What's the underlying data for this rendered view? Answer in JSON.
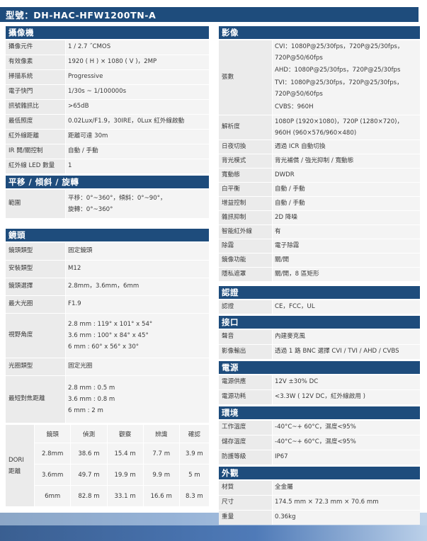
{
  "model": "型號：DH-HAC-HFW1200TN-A",
  "left": {
    "camera": {
      "title": "攝像機",
      "rows": [
        {
          "k": "攝像元件",
          "v": [
            "1 / 2.7 ˝CMOS"
          ]
        },
        {
          "k": "有效像素",
          "v": [
            "1920 ( H ) × 1080 ( V )，2MP"
          ]
        },
        {
          "k": "掃描系統",
          "v": [
            "Progressive"
          ]
        },
        {
          "k": "電子快門",
          "v": [
            "1/30s ~ 1/100000s"
          ]
        },
        {
          "k": "訊號雜訊比",
          "v": [
            ">65dB"
          ]
        },
        {
          "k": "最低照度",
          "v": [
            "0.02Lux/F1.9，30IRE，0Lux 紅外線啟動"
          ]
        },
        {
          "k": "紅外線距離",
          "v": [
            "距離可達 30m"
          ]
        },
        {
          "k": "IR 開/關控制",
          "v": [
            "自動 / 手動"
          ]
        },
        {
          "k": "紅外線 LED 數量",
          "v": [
            "1"
          ]
        }
      ]
    },
    "ptz": {
      "title": "平移 / 傾斜 / 旋轉",
      "rows": [
        {
          "k": "範圍",
          "v": [
            "平移：0°~360°，傾斜：0°~90°，",
            "旋轉：0°~360°"
          ]
        }
      ]
    },
    "lens": {
      "title": "鏡頭",
      "rows": [
        {
          "k": "鏡頭類型",
          "v": [
            "固定鏡頭"
          ]
        },
        {
          "k": "安裝類型",
          "v": [
            "M12"
          ]
        },
        {
          "k": "鏡頭選擇",
          "v": [
            "2.8mm，3.6mm，6mm"
          ]
        },
        {
          "k": "最大光圈",
          "v": [
            "F1.9"
          ]
        },
        {
          "k": "視野角度",
          "v": [
            "2.8 mm : 119° x 101° x 54°",
            "3.6 mm : 100° x 84° x 45°",
            "6 mm : 60° x 56° x 30°"
          ]
        },
        {
          "k": "光圈類型",
          "v": [
            "固定光圈"
          ]
        },
        {
          "k": "最短對焦距離",
          "v": [
            "2.8 mm : 0.5 m",
            "3.6 mm : 0.8 m",
            "6 mm : 2 m"
          ]
        }
      ]
    },
    "dori": {
      "label_top": "DORI",
      "label_bottom": "距離",
      "headers": [
        "鏡頭",
        "偵測",
        "觀察",
        "辨識",
        "確認"
      ],
      "rows": [
        [
          "2.8mm",
          "38.6 m",
          "15.4 m",
          "7.7 m",
          "3.9 m"
        ],
        [
          "3.6mm",
          "49.7 m",
          "19.9 m",
          "9.9 m",
          "5 m"
        ],
        [
          "6mm",
          "82.8 m",
          "33.1 m",
          "16.6 m",
          "8.3 m"
        ]
      ]
    }
  },
  "right": {
    "video": {
      "title": "影像",
      "res_key": "張數",
      "res_values": [
        "CVI：1080P@25/30fps，720P@25/30fps，720P@50/60fps",
        "AHD：1080P@25/30fps，720P@25/30fps",
        "TVI：1080P@25/30fps，720P@25/30fps，720P@50/60fps",
        "CVBS：960H"
      ],
      "rows": [
        {
          "k": "解析度",
          "v": [
            "1080P (1920×1080)，720P (1280×720)，",
            "960H (960×576/960×480)"
          ]
        },
        {
          "k": "日夜切換",
          "v": [
            "週過 ICR 自動切換"
          ]
        },
        {
          "k": "背光模式",
          "v": [
            "背光補償 / 強光抑制 / 寬動態"
          ]
        },
        {
          "k": "寬動態",
          "v": [
            "DWDR"
          ]
        },
        {
          "k": "白平衡",
          "v": [
            "自動 / 手動"
          ]
        },
        {
          "k": "增益控制",
          "v": [
            "自動 / 手動"
          ]
        },
        {
          "k": "雜訊抑制",
          "v": [
            "2D 降噪"
          ]
        },
        {
          "k": "智能紅外線",
          "v": [
            "有"
          ]
        },
        {
          "k": "除霧",
          "v": [
            "電子除霧"
          ]
        },
        {
          "k": "鏡像功能",
          "v": [
            "關/開"
          ]
        },
        {
          "k": "隱私遮罩",
          "v": [
            "關/開，8 區矩形"
          ]
        }
      ]
    },
    "cert": {
      "title": "認證",
      "rows": [
        {
          "k": "認證",
          "v": [
            "CE，FCC，UL"
          ]
        }
      ]
    },
    "iface": {
      "title": "接口",
      "rows": [
        {
          "k": "聲音",
          "v": [
            "內建麥克風"
          ]
        },
        {
          "k": "影像輸出",
          "v": [
            "透過 1 路 BNC 選擇 CVI / TVI / AHD / CVBS"
          ]
        }
      ]
    },
    "power": {
      "title": "電源",
      "rows": [
        {
          "k": "電源供應",
          "v": [
            "12V ±30% DC"
          ]
        },
        {
          "k": "電源功耗",
          "v": [
            "<3.3W ( 12V DC，紅外線啟用 )"
          ]
        }
      ]
    },
    "env": {
      "title": "環境",
      "rows": [
        {
          "k": "工作溫度",
          "v": [
            "-40°C~+ 60°C，濕度<95%"
          ]
        },
        {
          "k": "儲存溫度",
          "v": [
            "-40°C~+ 60°C，濕度<95%"
          ]
        },
        {
          "k": "防護等級",
          "v": [
            "IP67"
          ]
        }
      ]
    },
    "exterior": {
      "title": "外觀",
      "rows": [
        {
          "k": "材質",
          "v": [
            "全金屬"
          ]
        },
        {
          "k": "尺寸",
          "v": [
            "174.5 mm × 72.3 mm × 70.6 mm"
          ]
        },
        {
          "k": "重量",
          "v": [
            "0.36kg"
          ]
        }
      ]
    }
  }
}
